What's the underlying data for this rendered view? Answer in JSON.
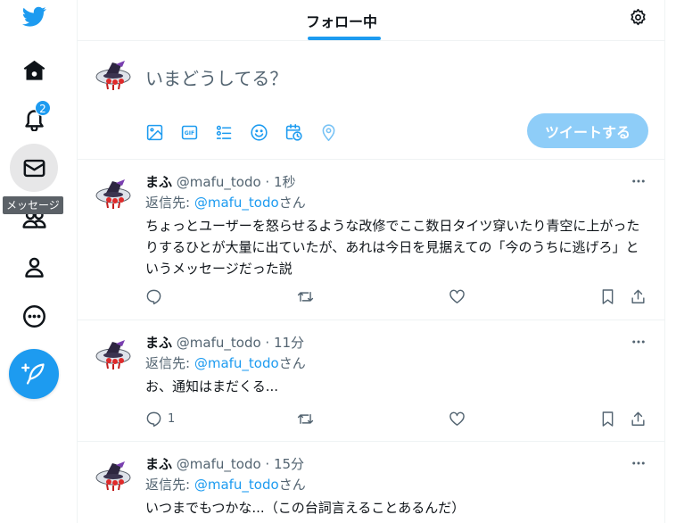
{
  "nav": {
    "logo_icon": "bird-icon",
    "notification_badge": "2",
    "tooltip": "メッセージ",
    "items": [
      "home-icon",
      "bell-icon",
      "mail-icon",
      "people-icon",
      "profile-icon",
      "more-circle-icon"
    ],
    "compose_icon": "feather-plus-icon"
  },
  "header": {
    "tab_label": "フォロー中",
    "settings_icon": "gear-icon"
  },
  "composer": {
    "placeholder": "いまどうしてる？",
    "tweet_button": "ツイートする",
    "tools": [
      "image-icon",
      "gif-icon",
      "poll-icon",
      "emoji-icon",
      "schedule-icon",
      "location-icon"
    ]
  },
  "tweets": [
    {
      "name": "まふ",
      "meta": "@mafu_todo · 1秒",
      "reply_prefix": "返信先: ",
      "reply_handle": "@mafu_todo",
      "reply_suffix": "さん",
      "body": "ちょっとユーザーを怒らせるような改修でここ数日タイツ穿いたり青空に上がったりするひとが大量に出ていたが、あれは今日を見据えての「今のうちに逃げろ」というメッセージだった説",
      "reply_count": ""
    },
    {
      "name": "まふ",
      "meta": "@mafu_todo · 11分",
      "reply_prefix": "返信先: ",
      "reply_handle": "@mafu_todo",
      "reply_suffix": "さん",
      "body": "お、通知はまだくる...",
      "reply_count": "1"
    },
    {
      "name": "まふ",
      "meta": "@mafu_todo · 15分",
      "reply_prefix": "返信先: ",
      "reply_handle": "@mafu_todo",
      "reply_suffix": "さん",
      "body": "いつまでもつかな...（この台詞言えることあるんだ）",
      "reply_count": ""
    }
  ],
  "colors": {
    "accent": "#1d9bf0",
    "tweet_button_disabled": "#8ecdf8",
    "text": "#0f1419",
    "muted": "#536471"
  }
}
